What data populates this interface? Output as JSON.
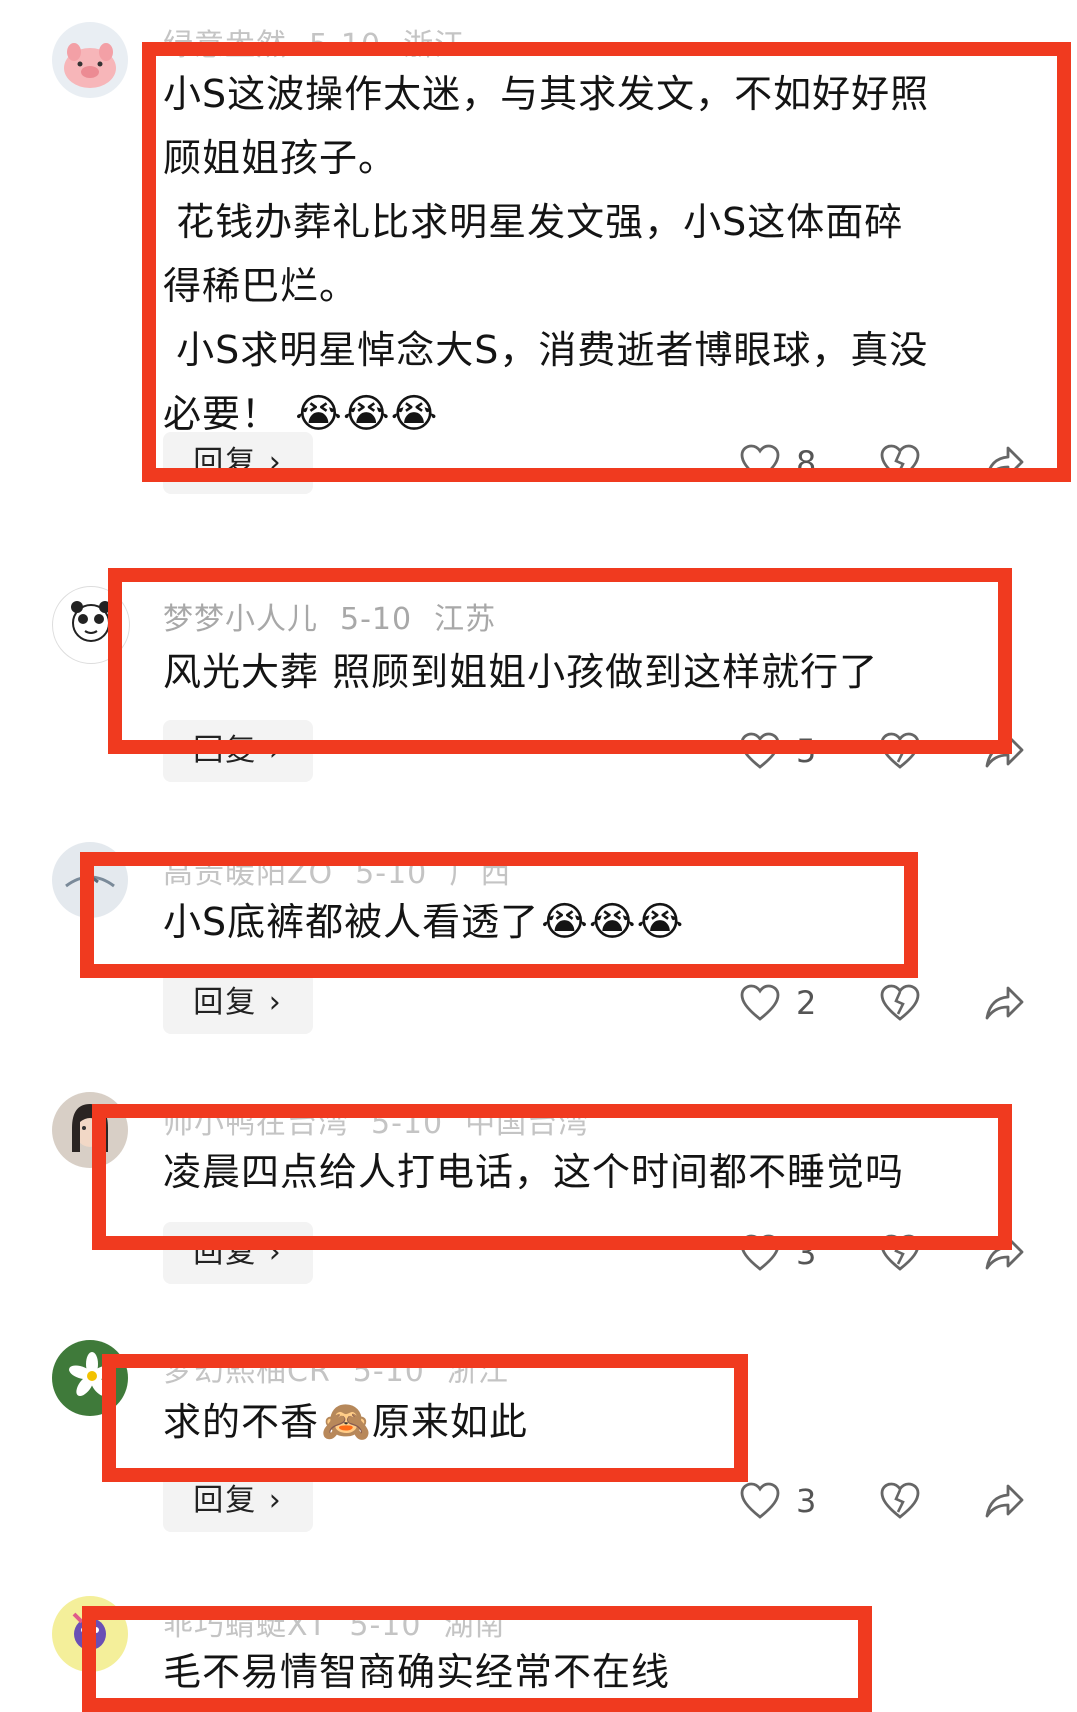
{
  "reply_label": "回复 ›",
  "comments": [
    {
      "username": "绿意盎然",
      "date": "5-10",
      "location": "浙江",
      "content": "小S这波操作太迷，与其求发文，不如好好照\n顾姐姐孩子。\n 花钱办葬礼比求明星发文强，小S这体面碎\n得稀巴烂。\n 小S求明星悼念大S，消费逝者博眼球，真没\n必要！",
      "emoji": "😭😭😭",
      "likes": "8",
      "avatar_icon": "pig-avatar"
    },
    {
      "username": "梦梦小人儿",
      "date": "5-10",
      "location": "江苏",
      "content": "风光大葬 照顾到姐姐小孩做到这样就行了",
      "emoji": "",
      "likes": "5",
      "avatar_icon": "panda-meme-avatar"
    },
    {
      "username": "高贵暖阳ZO",
      "date": "5-10",
      "location": "广西",
      "content": "小S底裤都被人看透了",
      "emoji": "😭😭😭",
      "likes": "2",
      "avatar_icon": "bird-avatar"
    },
    {
      "username": "帅小鸭在台湾",
      "date": "5-10",
      "location": "中国台湾",
      "content": "凌晨四点给人打电话，这个时间都不睡觉吗",
      "emoji": "",
      "likes": "3",
      "avatar_icon": "girl-avatar"
    },
    {
      "username": "梦幻熙柚CR",
      "date": "5-10",
      "location": "浙江",
      "content": "求的不香",
      "emoji": "🙈",
      "content_after": "原来如此",
      "likes": "3",
      "avatar_icon": "flower-avatar"
    },
    {
      "username": "乖巧蜻蜓XT",
      "date": "5-10",
      "location": "湖南",
      "content": "毛不易情智商确实经常不在线",
      "emoji": "",
      "likes": "",
      "avatar_icon": "cartoon-avatar"
    }
  ],
  "colors": {
    "highlight_box": "#f03a1f",
    "meta_text": "#a8a8a8",
    "reply_bg": "#f3f3f3"
  }
}
